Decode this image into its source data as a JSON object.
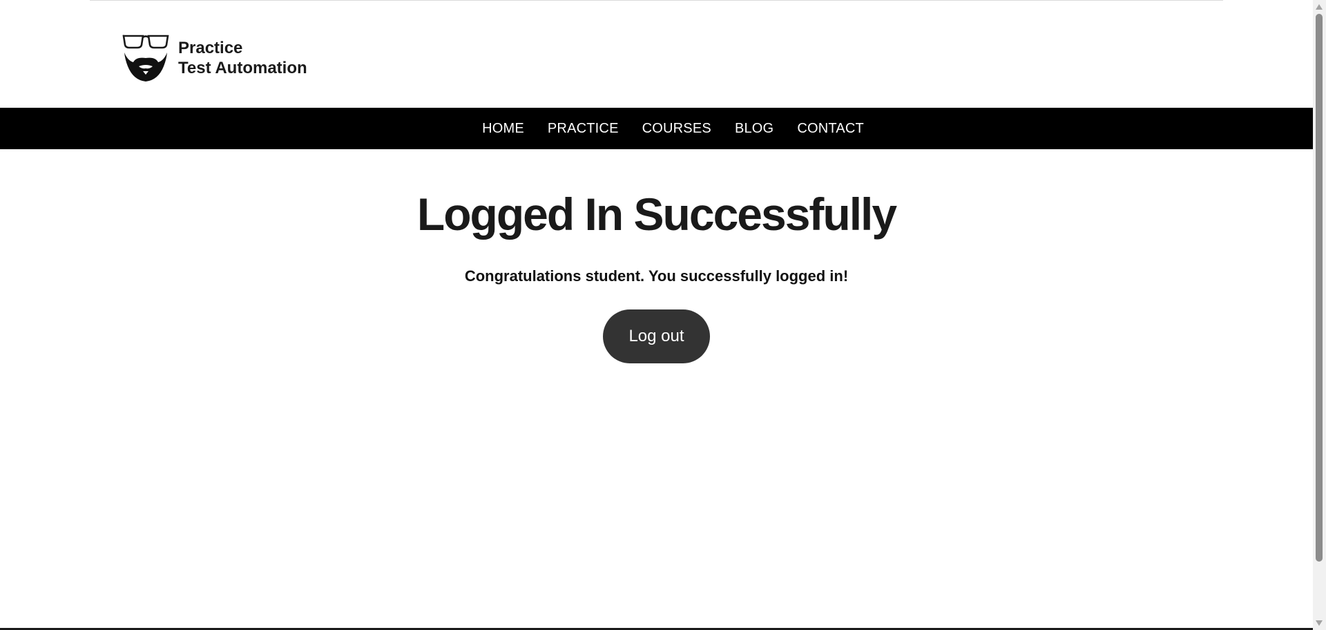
{
  "logo": {
    "line1": "Practice",
    "line2": "Test Automation",
    "icon": "glasses-beard-icon"
  },
  "nav": {
    "items": [
      {
        "label": "HOME"
      },
      {
        "label": "PRACTICE"
      },
      {
        "label": "COURSES"
      },
      {
        "label": "BLOG"
      },
      {
        "label": "CONTACT"
      }
    ]
  },
  "main": {
    "title": "Logged In Successfully",
    "message": "Congratulations student. You successfully logged in!",
    "logout_label": "Log out"
  },
  "colors": {
    "navbar_bg": "#000000",
    "button_bg": "#333333",
    "text": "#1a1a1a"
  }
}
